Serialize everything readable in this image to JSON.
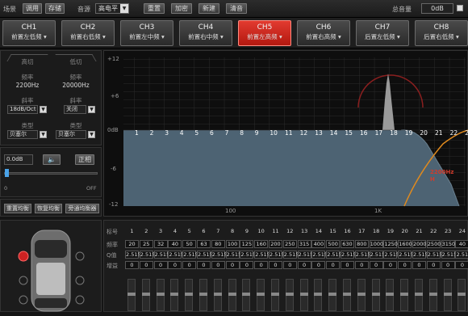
{
  "topbar": {
    "scene_label": "场景",
    "btn_tune": "调用",
    "btn_save": "存储",
    "source_label": "音源",
    "source_value": "高电平",
    "btn_reset": "重置",
    "btn_encrypt": "加密",
    "btn_new": "新建",
    "btn_clear": "清音",
    "total_gain_label": "总音量",
    "total_gain_value": "0dB"
  },
  "channels": [
    {
      "name": "CH1",
      "sub": "前置左低频"
    },
    {
      "name": "CH2",
      "sub": "前置右低频"
    },
    {
      "name": "CH3",
      "sub": "前置左中频"
    },
    {
      "name": "CH4",
      "sub": "前置右中频"
    },
    {
      "name": "CH5",
      "sub": "前置左高频"
    },
    {
      "name": "CH6",
      "sub": "前置右高频"
    },
    {
      "name": "CH7",
      "sub": "后置左低频"
    },
    {
      "name": "CH8",
      "sub": "后置右低频"
    }
  ],
  "filter": {
    "hp_title": "高切",
    "lp_title": "低切",
    "freq_label": "频率",
    "hp_freq": "2200Hz",
    "lp_freq": "20000Hz",
    "slope_label": "斜率",
    "hp_slope": "18dB/Oct",
    "lp_slope": "关闭",
    "type_label": "类型",
    "hp_type": "贝塞尔",
    "lp_type": "贝塞尔"
  },
  "gain": {
    "value": "0.0dB",
    "phase_btn": "正相",
    "min_label": "0",
    "max_label": "OFF"
  },
  "eq_buttons": {
    "reset": "重置均衡",
    "restore": "恢复均衡",
    "bypass": "旁通均衡器"
  },
  "graph": {
    "y_labels": [
      "+12",
      "+6",
      "0dB",
      "-6",
      "-12"
    ],
    "x_labels": [
      "100",
      "1K"
    ],
    "band_numbers": [
      "1",
      "2",
      "3",
      "4",
      "5",
      "6",
      "7",
      "8",
      "9",
      "10",
      "11",
      "12",
      "13",
      "14",
      "15",
      "16",
      "17",
      "18",
      "19",
      "20",
      "21",
      "22",
      "23"
    ],
    "marker_label": "2200Hz",
    "marker_sub": "H",
    "colors": {
      "fill": "#4d6373",
      "curve": "#e08a1e",
      "marker": "#d23b2b"
    }
  },
  "table": {
    "row_labels": [
      "标号",
      "频率",
      "Q值",
      "增益"
    ],
    "numbers": [
      "1",
      "2",
      "3",
      "4",
      "5",
      "6",
      "7",
      "8",
      "9",
      "10",
      "11",
      "12",
      "13",
      "14",
      "15",
      "16",
      "17",
      "18",
      "19",
      "20",
      "21",
      "22",
      "23",
      "24"
    ],
    "freqs": [
      "20",
      "25",
      "32",
      "40",
      "50",
      "63",
      "80",
      "100",
      "125",
      "160",
      "200",
      "250",
      "315",
      "400",
      "500",
      "630",
      "800",
      "1000",
      "1250",
      "1600",
      "2000",
      "2500",
      "3150",
      "40"
    ],
    "q_values": [
      "2.515",
      "2.515",
      "2.515",
      "2.515",
      "2.515",
      "2.515",
      "2.515",
      "2.515",
      "2.515",
      "2.515",
      "2.515",
      "2.515",
      "2.515",
      "2.515",
      "2.515",
      "2.515",
      "2.515",
      "2.515",
      "2.515",
      "2.515",
      "2.515",
      "2.515",
      "2.515",
      "2.51"
    ],
    "gains": [
      "0",
      "0",
      "0",
      "0",
      "0",
      "0",
      "0",
      "0",
      "0",
      "0",
      "0",
      "0",
      "0",
      "0",
      "0",
      "0",
      "0",
      "0",
      "0",
      "0",
      "0",
      "0",
      "0",
      "0"
    ]
  }
}
